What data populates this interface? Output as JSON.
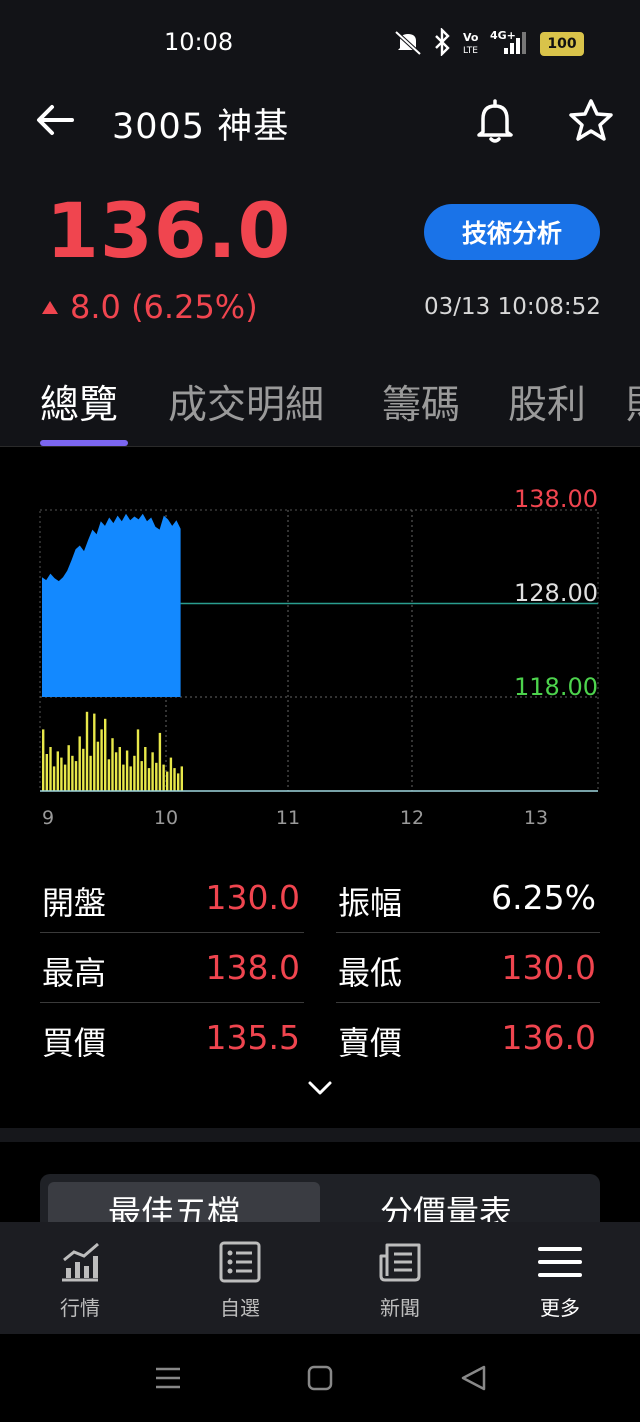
{
  "status_bar": {
    "time": "10:08",
    "battery": "100",
    "network": "4G+"
  },
  "header": {
    "stock_title": "3005 神基"
  },
  "quote": {
    "price": "136.0",
    "change": "8.0 (6.25%)",
    "timestamp": "03/13 10:08:52",
    "tech_button": "技術分析",
    "color_up": "#f0454f"
  },
  "tabs": [
    "總覽",
    "成交明細",
    "籌碼",
    "股利"
  ],
  "chart": {
    "price_labels": {
      "high": "138.00",
      "mid": "128.00",
      "low": "118.00"
    },
    "time_labels": [
      "9",
      "10",
      "11",
      "12",
      "13"
    ],
    "colors": {
      "price_fill": "#1389ff",
      "volume": "#e8e84a",
      "high": "#f0454f",
      "low": "#4dd34d",
      "ref_line": "#2a9d8f"
    }
  },
  "chart_data": {
    "type": "area",
    "x_domain": [
      "9",
      "13"
    ],
    "ylim": [
      118,
      138
    ],
    "reference": 128,
    "series": [
      {
        "values": [
          130.8,
          130.5,
          131.2,
          130.7,
          130.4,
          130.8,
          131.5,
          132.6,
          133.8,
          134.2,
          133.6,
          134.8,
          135.9,
          135.4,
          136.8,
          136.3,
          137.2,
          136.6,
          137.4,
          136.8,
          137.6,
          136.9,
          137.3,
          137.0,
          137.6,
          136.8,
          137.2,
          136.2,
          135.9,
          137.4,
          137.0,
          136.3,
          136.9,
          136.0
        ]
      },
      {
        "values": [
          70,
          42,
          50,
          28,
          45,
          38,
          30,
          52,
          40,
          34,
          62,
          48,
          90,
          40,
          88,
          56,
          70,
          82,
          36,
          60,
          44,
          50,
          30,
          46,
          28,
          40,
          70,
          34,
          50,
          26,
          44,
          32,
          66,
          30,
          22,
          38,
          26,
          20,
          28
        ]
      }
    ]
  },
  "stats": [
    {
      "label": "開盤",
      "value": "130.0"
    },
    {
      "label": "振幅",
      "value": "6.25%"
    },
    {
      "label": "最高",
      "value": "138.0"
    },
    {
      "label": "最低",
      "value": "130.0"
    },
    {
      "label": "買價",
      "value": "135.5"
    },
    {
      "label": "賣價",
      "value": "136.0"
    }
  ],
  "segmented": {
    "left": "最佳五檔",
    "right": "分價量表"
  },
  "bottom_nav": [
    {
      "label": "行情",
      "icon": "chart-icon"
    },
    {
      "label": "自選",
      "icon": "list-icon"
    },
    {
      "label": "新聞",
      "icon": "news-icon"
    },
    {
      "label": "更多",
      "icon": "menu-icon"
    }
  ]
}
